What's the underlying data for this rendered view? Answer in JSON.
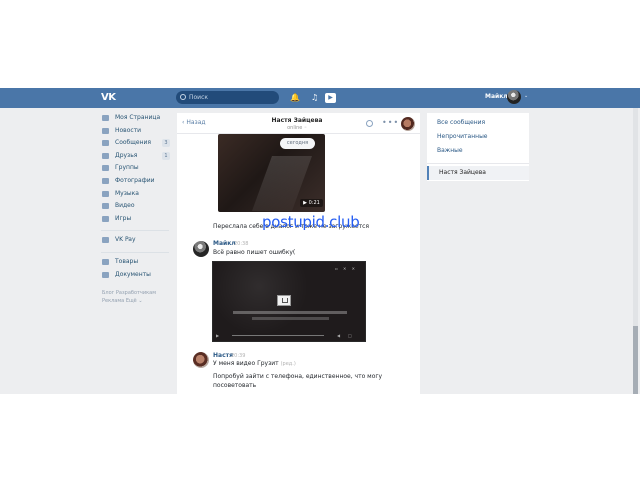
{
  "topbar": {
    "logo": "VK",
    "search_placeholder": "Поиск",
    "user_name": "Майкл"
  },
  "sidebar": {
    "items": [
      {
        "label": "Моя Страница",
        "icon": "home-icon"
      },
      {
        "label": "Новости",
        "icon": "news-icon"
      },
      {
        "label": "Сообщения",
        "icon": "messages-icon",
        "badge": "3"
      },
      {
        "label": "Друзья",
        "icon": "friends-icon",
        "badge": "1"
      },
      {
        "label": "Группы",
        "icon": "groups-icon"
      },
      {
        "label": "Фотографии",
        "icon": "photos-icon"
      },
      {
        "label": "Музыка",
        "icon": "music-icon"
      },
      {
        "label": "Видео",
        "icon": "video-icon"
      },
      {
        "label": "Игры",
        "icon": "games-icon"
      }
    ],
    "vkpay": "VK Pay",
    "goods": "Товары",
    "documents": "Документы",
    "footer": [
      "Блог",
      "Разработчикам",
      "Реклама",
      "Ещё"
    ]
  },
  "chat": {
    "back": "Назад",
    "name": "Настя Зайцева",
    "status": "online",
    "today": "сегодня",
    "duration": "0:21",
    "forwarded_text": "Переслала себе в диалог и тоже не загружается",
    "messages": [
      {
        "author": "Майкл",
        "time": "20:38",
        "text": "Всё равно пишет ошибку("
      },
      {
        "author": "Настя",
        "time": "20:39",
        "text": "У меня видео Грузит",
        "edited": "(ред.)",
        "text2": "Попробуй зайти с телефона, единственное, что могу",
        "text3": "посоветовать"
      }
    ]
  },
  "right_panel": {
    "items": [
      "Все сообщения",
      "Непрочитанные",
      "Важные"
    ],
    "active": "Настя Зайцева"
  },
  "overlay": {
    "watermark": "postupid.club"
  }
}
